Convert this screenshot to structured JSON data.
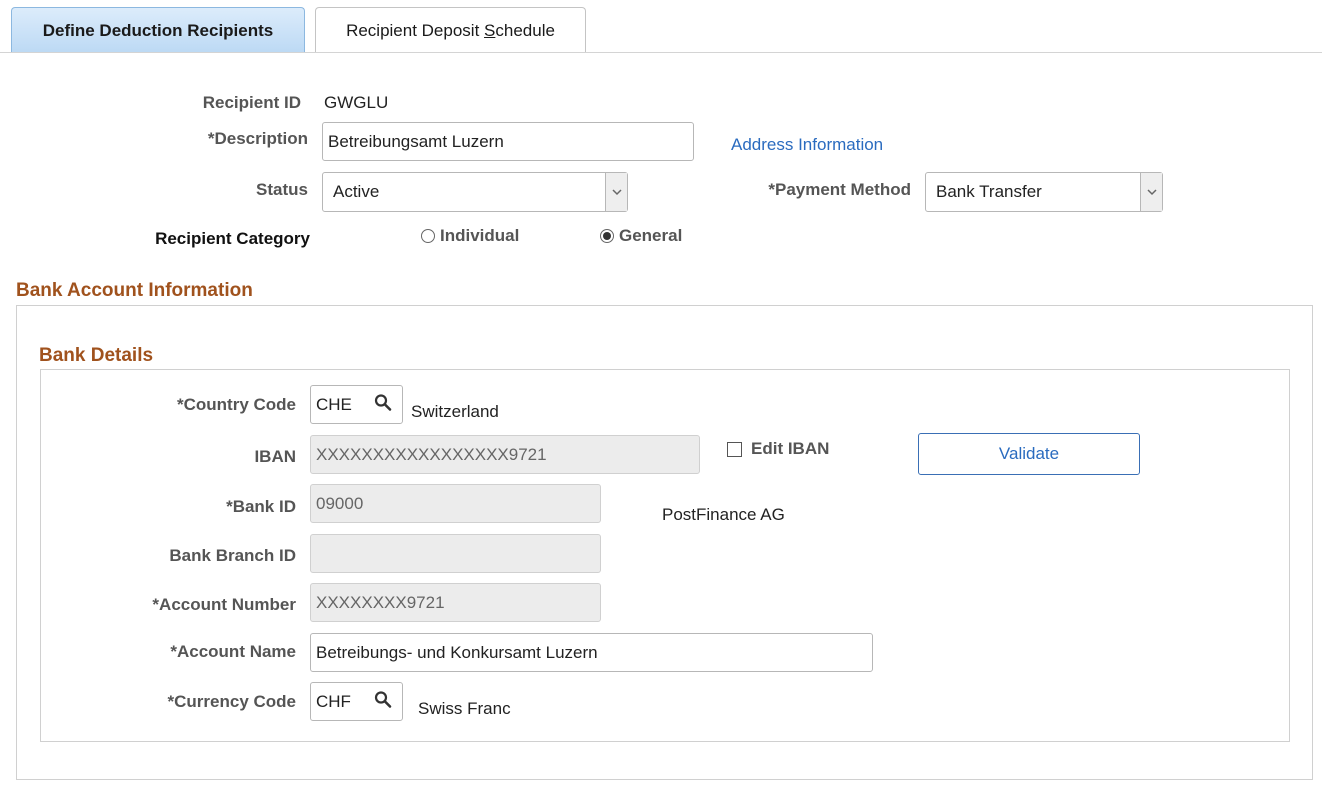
{
  "tabs": [
    {
      "label": "Define Deduction Recipients",
      "active": true
    },
    {
      "label_pre": "Recipient Deposit ",
      "label_underlined": "S",
      "label_post": "chedule",
      "active": false
    }
  ],
  "header": {
    "recipient_id_label": "Recipient ID",
    "recipient_id_value": "GWGLU",
    "description_label": "*Description",
    "description_value": "Betreibungsamt Luzern",
    "address_link": "Address Information",
    "status_label": "Status",
    "status_value": "Active",
    "payment_method_label": "*Payment Method",
    "payment_method_value": "Bank Transfer",
    "category_label": "Recipient Category",
    "category_options": [
      "Individual",
      "General"
    ],
    "category_selected": "General"
  },
  "bank_account": {
    "section_title": "Bank Account Information",
    "details_title": "Bank Details",
    "country_code_label": "*Country Code",
    "country_code_value": "CHE",
    "country_name": "Switzerland",
    "iban_label": "IBAN",
    "iban_value": "XXXXXXXXXXXXXXXXX9721",
    "edit_iban_label": "Edit IBAN",
    "edit_iban_checked": false,
    "validate_label": "Validate",
    "bank_id_label": "*Bank ID",
    "bank_id_value": "09000",
    "bank_name": "PostFinance AG",
    "branch_id_label": "Bank Branch ID",
    "branch_id_value": "",
    "account_number_label": "*Account Number",
    "account_number_value": "XXXXXXXX9721",
    "account_name_label": "*Account Name",
    "account_name_value": "Betreibungs- und Konkursamt Luzern",
    "currency_code_label": "*Currency Code",
    "currency_code_value": "CHF",
    "currency_name": "Swiss Franc"
  },
  "icons": {
    "lookup": "search-icon",
    "dropdown": "chevron-down-icon"
  },
  "colors": {
    "section_title": "#a0521d",
    "link": "#2a6bbf",
    "active_tab": "#bcd9f4"
  }
}
